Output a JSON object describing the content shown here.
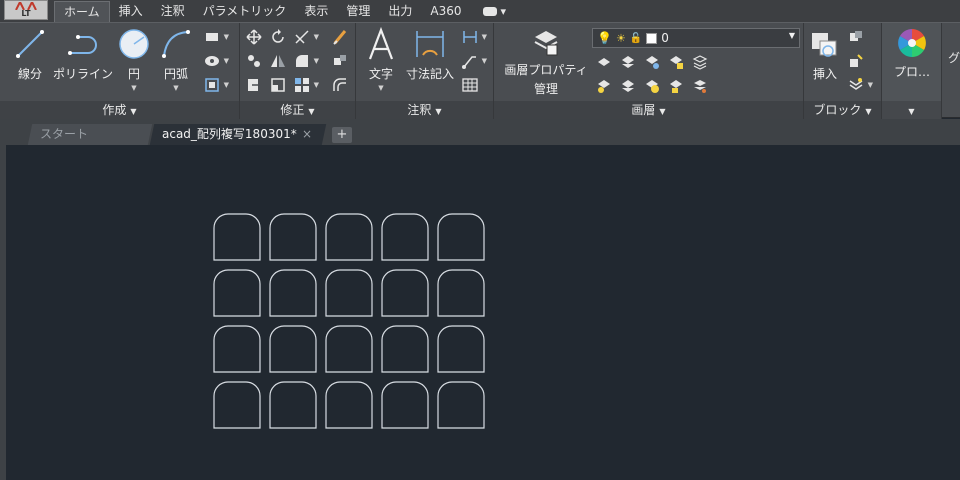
{
  "app_button": {
    "label": "LT"
  },
  "menu_tabs": [
    "ホーム",
    "挿入",
    "注釈",
    "パラメトリック",
    "表示",
    "管理",
    "出力",
    "A360"
  ],
  "menu_extra": "▾",
  "ribbon": {
    "draw": {
      "title": "作成",
      "line": "線分",
      "polyline": "ポリライン",
      "circle": "円",
      "arc": "円弧"
    },
    "modify": {
      "title": "修正"
    },
    "annotation": {
      "title": "注釈",
      "text": "文字",
      "dimension": "寸法記入"
    },
    "layers": {
      "title": "画層",
      "properties_line1": "画層プロパティ",
      "properties_line2": "管理",
      "current_layer": "0"
    },
    "block": {
      "title": "ブロック",
      "insert": "挿入"
    },
    "properties": {
      "label": "プロ…"
    },
    "clipped_label": "グ"
  },
  "file_tabs": {
    "start": "スタート",
    "document": "acad_配列複写180301*",
    "close": "×",
    "add": "+"
  },
  "drawing": {
    "shape": "arch",
    "rows": 4,
    "columns": 5,
    "stroke_color": "#d8dde3"
  },
  "colors": {
    "canvas_bg": "#212830",
    "ribbon_bg": "#4a4d51",
    "menubar_bg": "#3d3f42"
  }
}
